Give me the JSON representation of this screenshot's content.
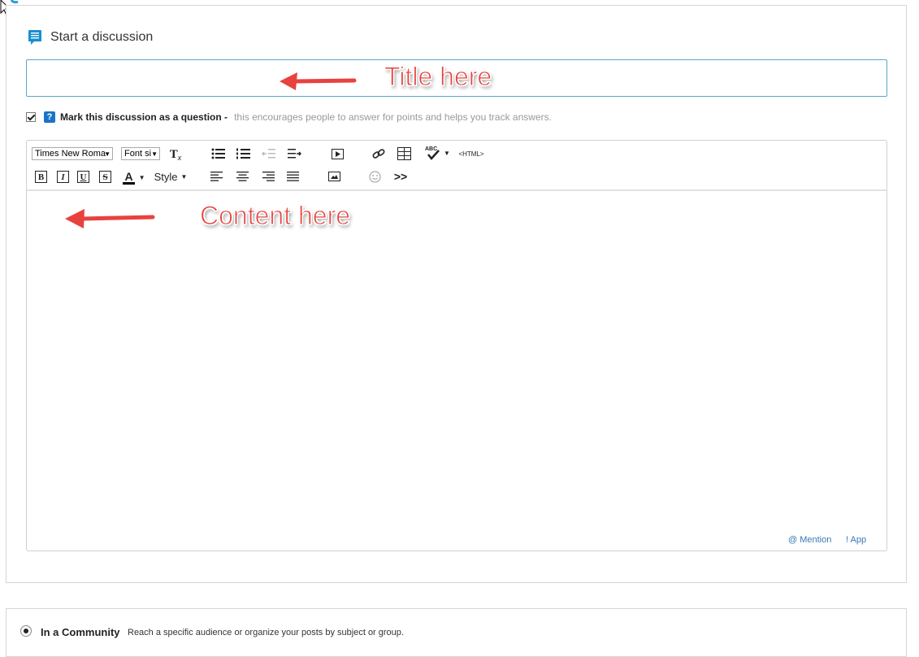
{
  "heading": {
    "title": "Start a discussion",
    "icon": "discussion-icon"
  },
  "title_field": {
    "value": "",
    "placeholder": ""
  },
  "question_option": {
    "label": "Mark this discussion as a question -",
    "description": "this encourages people to answer for points and helps you track answers.",
    "checked": true
  },
  "toolbar": {
    "font_family": "Times New Roma",
    "font_size": "Font si",
    "clear_format_glyph": "T",
    "bold": "B",
    "italic": "I",
    "underline": "U",
    "strike": "S",
    "text_color_glyph": "A",
    "style_label": "Style",
    "spellcheck_glyph": "ABC",
    "html_label": "<HTML>",
    "more_glyph": ">>"
  },
  "editor": {
    "content": ""
  },
  "footer_links": {
    "mention": "@ Mention",
    "app": "! App"
  },
  "location": {
    "option_label": "In a Community",
    "option_desc": "Reach a specific audience or organize your posts by subject or group.",
    "selected": true
  },
  "annotations": {
    "title_hint": "Title here",
    "content_hint": "Content here"
  },
  "colors": {
    "accent": "#1a73c8",
    "annotation": "#e8423f",
    "link": "#3a78b5",
    "input_focus": "#5aa6c7"
  }
}
